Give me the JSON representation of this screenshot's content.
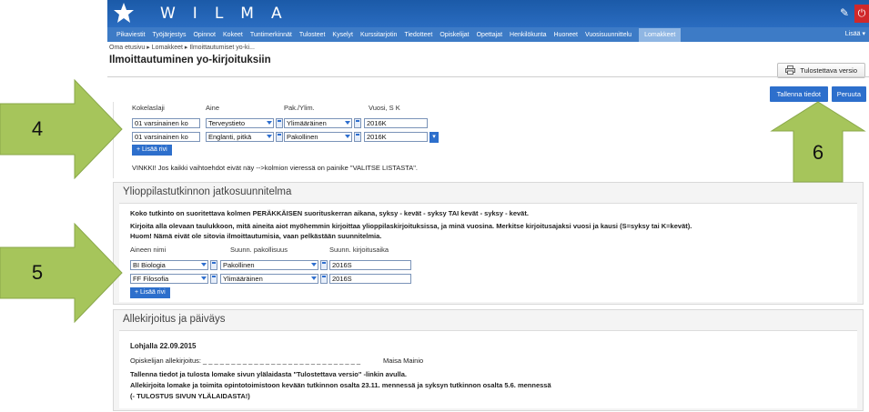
{
  "app": {
    "logo_text": "WILMA",
    "tool_icon": "wrench-icon",
    "power_icon": "power-icon"
  },
  "nav": {
    "items": [
      "Pikaviestit",
      "Työjärjestys",
      "Opinnot",
      "Kokeet",
      "Tuntimerkinnät",
      "Tulosteet",
      "Kyselyt",
      "Kurssitarjotin",
      "Tiedotteet",
      "Opiskelijat",
      "Opettajat",
      "Henkilökunta",
      "Huoneet",
      "Vuosisuunnittelu",
      "Lomakkeet"
    ],
    "active": "Lomakkeet",
    "more": "Lisää ▾"
  },
  "breadcrumb": "Oma etusivu ▸ Lomakkeet ▸ Ilmoittautumiset yo-ki...",
  "page_title": "Ilmoittautuminen yo-kirjoituksiin",
  "buttons": {
    "print": "Tulostettava versio",
    "save": "Tallenna tiedot",
    "cancel": "Peruuta",
    "add_row": "+ Lisää rivi"
  },
  "exams": {
    "headers": [
      "Kokelaslaji",
      "Aine",
      "Pak./Ylim.",
      "Vuosi, S K"
    ],
    "rows": [
      {
        "kokelaslaji": "01 varsinainen ko",
        "aine": "Terveystieto",
        "pak": "Ylimääräinen",
        "vuosi": "2016K"
      },
      {
        "kokelaslaji": "01 varsinainen ko",
        "aine": "Englanti, pitkä",
        "pak": "Pakollinen",
        "vuosi": "2016K"
      }
    ],
    "hint": "VINKKI! Jos kaikki vaihtoehdot eivät näy -->kolmion vieressä on painike \"VALITSE LISTASTA\"."
  },
  "plan": {
    "title": "Ylioppilastutkinnon jatkosuunnitelma",
    "text1": "Koko tutkinto on suoritettava kolmen PERÄKKÄISEN suorituskerran aikana, syksy - kevät - syksy TAI kevät - syksy - kevät.",
    "text2": "Kirjoita alla olevaan taulukkoon, mitä aineita aiot myöhemmin kirjoittaa ylioppilaskirjoituksissa, ja minä vuosina. Merkitse kirjoitusajaksi vuosi ja kausi (S=syksy tai K=kevät).",
    "text3": "Huom! Nämä eivät ole sitovia ilmoittautumisia, vaan pelkästään suunnitelmia.",
    "headers": [
      "Aineen nimi",
      "Suunn. pakollisuus",
      "Suunn. kirjoitusaika"
    ],
    "rows": [
      {
        "aine": "BI Biologia",
        "pak": "Pakollinen",
        "aika": "2016S"
      },
      {
        "aine": "FF Filosofia",
        "pak": "Ylimääräinen",
        "aika": "2016S"
      }
    ]
  },
  "sign": {
    "title": "Allekirjoitus ja päiväys",
    "place_date": "Lohjalla    22.09.2015",
    "signature_label": "Opiskelijan allekirjoitus:  _ _ _ _ _ _ _ _ _ _ _ _ _ _ _ _ _ _ _ _ _ _ _ _ _ _ _ _",
    "student_name": "Maisa Mainio",
    "text1": "Tallenna tiedot ja tulosta lomake sivun ylälaidasta \"Tulostettava versio\" -linkin avulla.",
    "text2": "Allekirjoita lomake ja toimita opintotoimistoon kevään tutkinnon osalta 23.11. mennessä ja syksyn tutkinnon osalta 5.6. mennessä",
    "text3": "(- TULOSTUS SIVUN YLÄLAIDASTA!)"
  },
  "annotations": {
    "label_4": "4",
    "label_5": "5",
    "label_6": "6",
    "color": "#a6c55b"
  }
}
